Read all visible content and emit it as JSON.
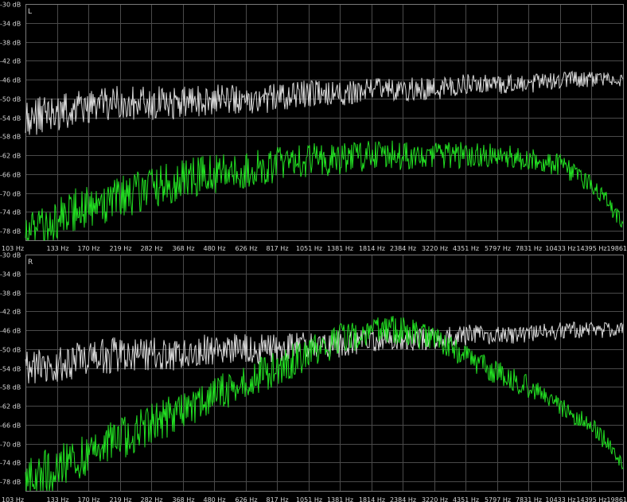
{
  "colors": {
    "background": "#000000",
    "grid": "#4a4a4a",
    "text": "#d8d8d8",
    "series_white": "#d8d8d8",
    "series_green": "#22e022"
  },
  "chart_data": [
    {
      "type": "line",
      "channel_label": "L",
      "y_ticks": [
        "-30 dB",
        "-34 dB",
        "-38 dB",
        "-42 dB",
        "-46 dB",
        "-50 dB",
        "-54 dB",
        "-58 dB",
        "-62 dB",
        "-66 dB",
        "-70 dB",
        "-74 dB",
        "-78 dB"
      ],
      "x_ticks": [
        "103 Hz",
        "133 Hz",
        "170 Hz",
        "219 Hz",
        "282 Hz",
        "368 Hz",
        "480 Hz",
        "626 Hz",
        "817 Hz",
        "1051 Hz",
        "1381 Hz",
        "1814 Hz",
        "2384 Hz",
        "3220 Hz",
        "4351 Hz",
        "5797 Hz",
        "7831 Hz",
        "10433 Hz",
        "14395 Hz",
        "19861"
      ],
      "x_scale": "log",
      "ylim": [
        -80,
        -30
      ],
      "xlim": [
        103,
        19861
      ],
      "grid": true,
      "series": [
        {
          "color": "#d8d8d8",
          "x": [
            103,
            133,
            170,
            219,
            282,
            368,
            480,
            626,
            817,
            1051,
            1381,
            1814,
            2384,
            3220,
            4351,
            5797,
            7831,
            10433,
            14395,
            19861
          ],
          "y": [
            -54,
            -53,
            -52,
            -51,
            -51,
            -51,
            -50,
            -50,
            -50,
            -49,
            -49,
            -48,
            -48,
            -48,
            -47,
            -47,
            -47,
            -46,
            -46,
            -46
          ]
        },
        {
          "color": "#22e022",
          "x": [
            103,
            133,
            170,
            219,
            282,
            368,
            480,
            626,
            817,
            1051,
            1381,
            1814,
            2384,
            3220,
            4351,
            5797,
            7831,
            10433,
            14395,
            19861
          ],
          "y": [
            -78,
            -75,
            -73,
            -71,
            -69,
            -67,
            -66,
            -65,
            -64,
            -63,
            -63,
            -62,
            -62,
            -62,
            -62,
            -62,
            -63,
            -64,
            -68,
            -76
          ]
        }
      ]
    },
    {
      "type": "line",
      "channel_label": "R",
      "y_ticks": [
        "-30 dB",
        "-34 dB",
        "-38 dB",
        "-42 dB",
        "-46 dB",
        "-50 dB",
        "-54 dB",
        "-58 dB",
        "-62 dB",
        "-66 dB",
        "-70 dB",
        "-74 dB",
        "-78 dB"
      ],
      "x_ticks": [
        "103 Hz",
        "133 Hz",
        "170 Hz",
        "219 Hz",
        "282 Hz",
        "368 Hz",
        "480 Hz",
        "626 Hz",
        "817 Hz",
        "1051 Hz",
        "1381 Hz",
        "1814 Hz",
        "2384 Hz",
        "3220 Hz",
        "4351 Hz",
        "5797 Hz",
        "7831 Hz",
        "10433 Hz",
        "14395 Hz",
        "19861"
      ],
      "x_scale": "log",
      "ylim": [
        -80,
        -30
      ],
      "xlim": [
        103,
        19861
      ],
      "grid": true,
      "series": [
        {
          "color": "#d8d8d8",
          "x": [
            103,
            133,
            170,
            219,
            282,
            368,
            480,
            626,
            817,
            1051,
            1381,
            1814,
            2384,
            3220,
            4351,
            5797,
            7831,
            10433,
            14395,
            19861
          ],
          "y": [
            -54,
            -53,
            -52,
            -51,
            -51,
            -51,
            -50,
            -50,
            -50,
            -49,
            -49,
            -48,
            -48,
            -48,
            -47,
            -47,
            -47,
            -46,
            -46,
            -46
          ]
        },
        {
          "color": "#22e022",
          "x": [
            103,
            133,
            170,
            219,
            282,
            368,
            480,
            626,
            817,
            1051,
            1381,
            1814,
            2384,
            3220,
            4351,
            5797,
            7831,
            10433,
            14395,
            19861
          ],
          "y": [
            -78,
            -75,
            -72,
            -69,
            -66,
            -63,
            -60,
            -57,
            -54,
            -51,
            -48,
            -46,
            -46,
            -48,
            -52,
            -55,
            -58,
            -62,
            -66,
            -74
          ]
        }
      ]
    }
  ]
}
